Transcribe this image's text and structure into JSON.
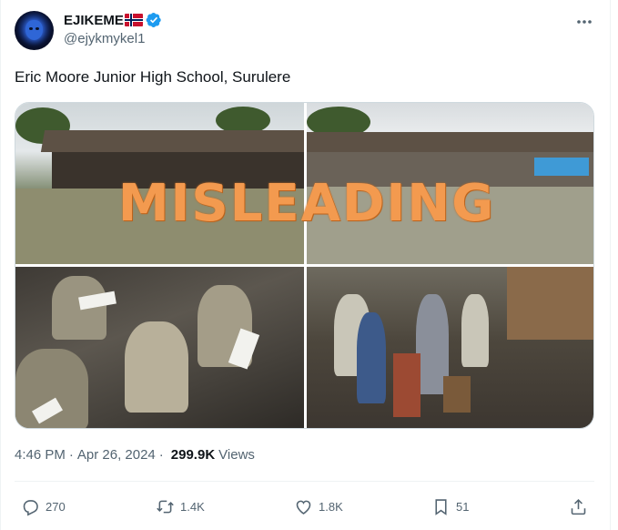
{
  "user": {
    "display_name": "EJIKEME",
    "flag_icon": "norway-flag-icon",
    "verified_color": "#1d9bf0",
    "handle": "@ejykmykel1"
  },
  "tweet": {
    "text": "Eric Moore Junior High School, Surulere"
  },
  "media": {
    "overlay_text": "MISLEADING",
    "overlay_color": "#f39a4f",
    "photo_count": 4
  },
  "meta": {
    "time": "4:46 PM",
    "separator": "·",
    "date": "Apr 26, 2024",
    "views_count": "299.9K",
    "views_label": "Views"
  },
  "actions": {
    "reply_count": "270",
    "retweet_count": "1.4K",
    "like_count": "1.8K",
    "bookmark_count": "51"
  },
  "colors": {
    "text_primary": "#0f1419",
    "text_secondary": "#536471",
    "border": "#eff3f4"
  }
}
